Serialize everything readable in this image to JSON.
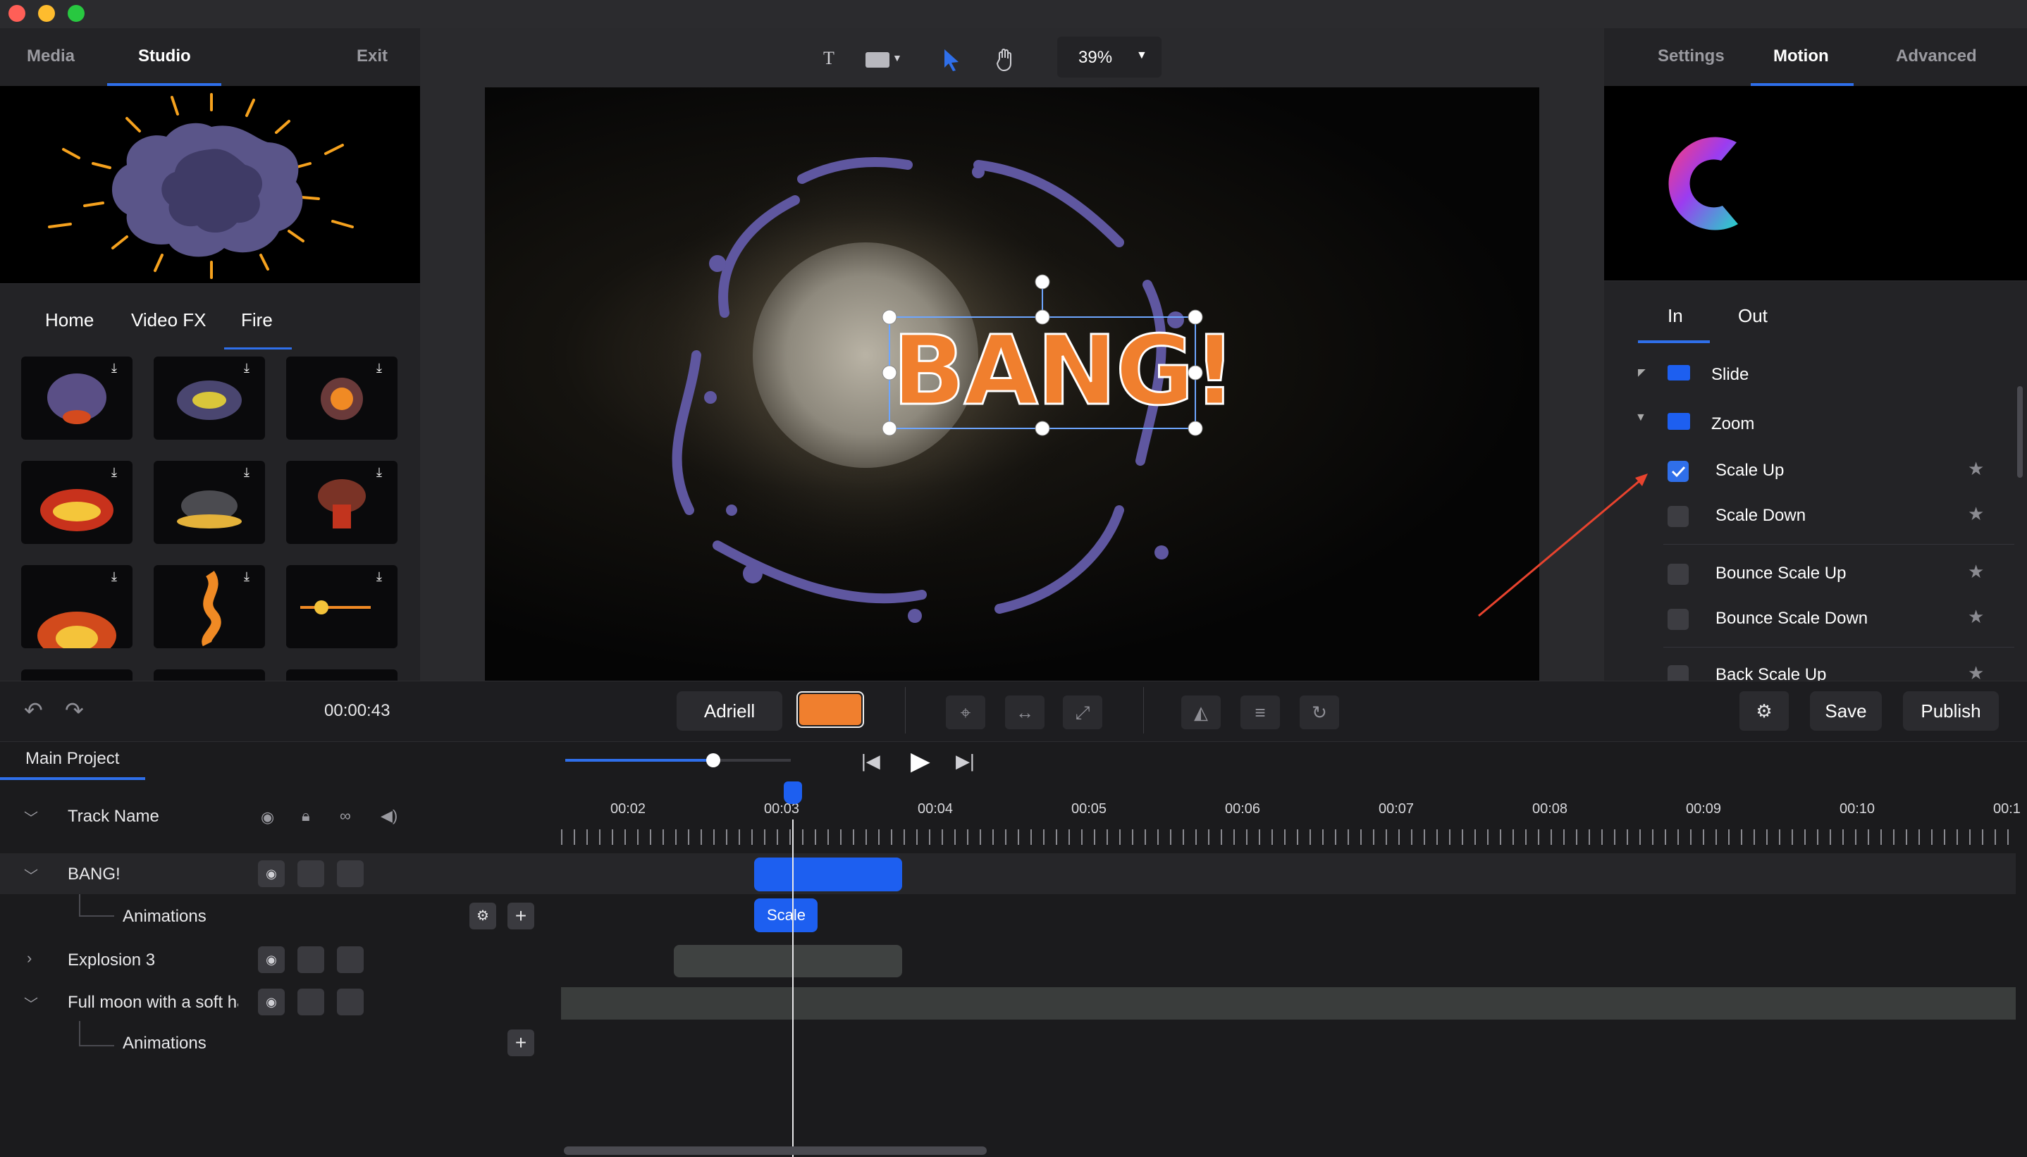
{
  "left_panel": {
    "tabs": [
      "Media",
      "Studio",
      "Exit"
    ],
    "active_tab": "Studio",
    "subtabs": [
      "Home",
      "Video FX",
      "Fire"
    ],
    "active_subtab": "Fire"
  },
  "canvas_toolbar": {
    "text_tool": "T",
    "zoom": "39%"
  },
  "canvas": {
    "text_object": "BANG!"
  },
  "right_panel": {
    "tabs": [
      "Settings",
      "Motion",
      "Advanced"
    ],
    "active_tab": "Motion",
    "inout_tabs": [
      "In",
      "Out"
    ],
    "active_inout": "In",
    "folders": [
      {
        "label": "Slide",
        "expanded": false
      },
      {
        "label": "Zoom",
        "expanded": true
      }
    ],
    "animations": [
      {
        "label": "Scale Up",
        "checked": true
      },
      {
        "label": "Scale Down",
        "checked": false
      },
      {
        "label": "Bounce Scale Up",
        "checked": false
      },
      {
        "label": "Bounce Scale Down",
        "checked": false
      },
      {
        "label": "Back Scale Up",
        "checked": false
      }
    ]
  },
  "toolbar": {
    "time": "00:00:43",
    "font_name": "Adriell",
    "color_swatch": "#f07f2e",
    "save_label": "Save",
    "publish_label": "Publish"
  },
  "timeline": {
    "project_tab": "Main Project",
    "header_label": "Track Name",
    "ruler_labels": [
      "00:02",
      "00:03",
      "00:04",
      "00:05",
      "00:06",
      "00:07",
      "00:08",
      "00:09",
      "00:10",
      "00:1"
    ],
    "tracks": [
      {
        "name": "BANG!",
        "expanded": true
      },
      {
        "name": "Explosion 3",
        "expanded": false
      },
      {
        "name": "Full moon with a soft ha",
        "expanded": true
      }
    ],
    "animations_label": "Animations",
    "clip_label": "Scale"
  },
  "colors": {
    "accent": "#2f6fea",
    "clip_blue": "#1d5ff0",
    "orange": "#f07f2e"
  }
}
